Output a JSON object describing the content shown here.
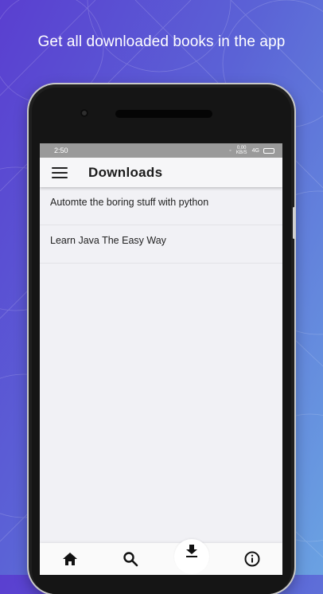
{
  "promo": {
    "headline": "Get all downloaded books in the app"
  },
  "status_bar": {
    "time": "2:50",
    "speed": "0.00 KB/S",
    "network": "4G"
  },
  "app_bar": {
    "title": "Downloads",
    "menu_icon": "hamburger-menu-icon"
  },
  "downloads": [
    {
      "title": "Automte the boring stuff with python"
    },
    {
      "title": "Learn Java The Easy Way"
    }
  ],
  "bottom_nav": {
    "items": [
      {
        "name": "home",
        "icon": "home-icon",
        "active": false
      },
      {
        "name": "search",
        "icon": "search-icon",
        "active": false
      },
      {
        "name": "downloads",
        "icon": "download-icon",
        "active": true
      },
      {
        "name": "about",
        "icon": "info-icon",
        "active": false
      }
    ]
  },
  "colors": {
    "background_start": "#5a3fd0",
    "background_end": "#6aa2e2",
    "status_bar": "#9a9a9a",
    "screen_bg": "#f1f1f5"
  }
}
